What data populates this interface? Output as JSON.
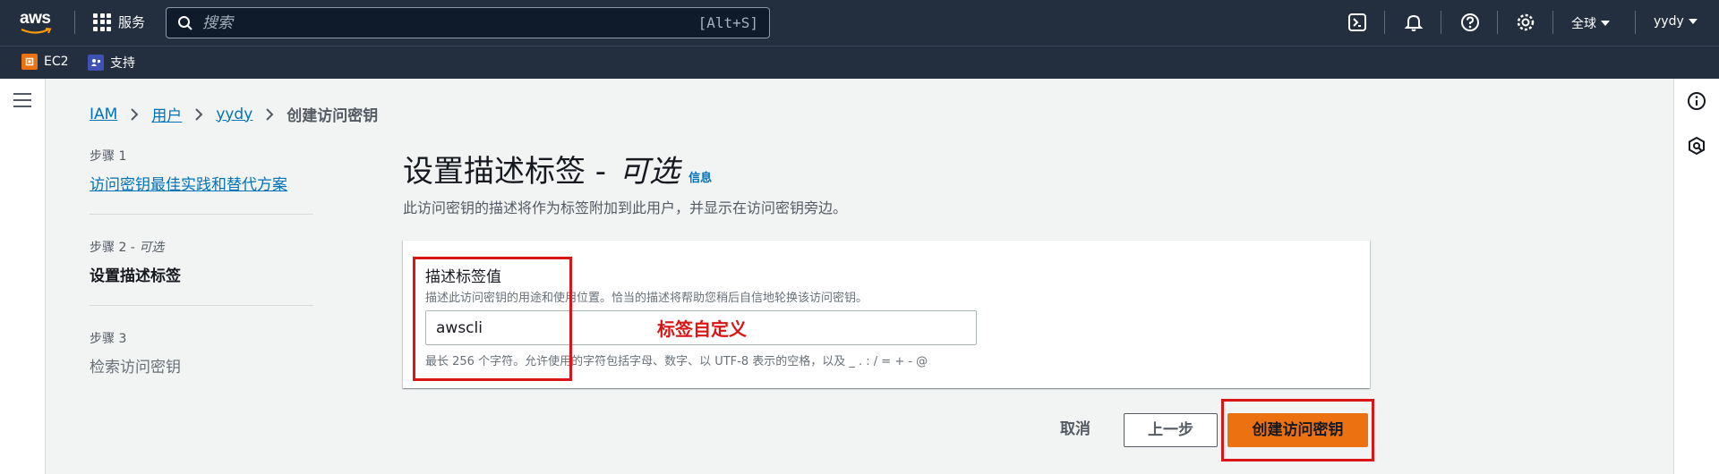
{
  "nav": {
    "logo_text": "aws",
    "services_label": "服务",
    "search_placeholder": "搜索",
    "search_shortcut": "[Alt+S]",
    "region_label": "全球",
    "user_label": "yydy"
  },
  "favorites": [
    {
      "label": "EC2",
      "color": "#ec7211"
    },
    {
      "label": "支持",
      "color": "#3f51b5"
    }
  ],
  "breadcrumb": {
    "items": [
      "IAM",
      "用户",
      "yydy"
    ],
    "current": "创建访问密钥"
  },
  "steps": [
    {
      "num": "步骤 1",
      "title": "访问密钥最佳实践和替代方案"
    },
    {
      "num": "步骤 2",
      "opt": "可选",
      "title": "设置描述标签"
    },
    {
      "num": "步骤 3",
      "title": "检索访问密钥"
    }
  ],
  "main": {
    "title": "设置描述标签 -",
    "title_opt": "可选",
    "info_link": "信息",
    "description": "此访问密钥的描述将作为标签附加到此用户，并显示在访问密钥旁边。"
  },
  "field": {
    "label": "描述标签值",
    "description": "描述此访问密钥的用途和使用位置。恰当的描述将帮助您稍后自信地轮换该访问密钥。",
    "value": "awscli",
    "hint": "最长 256 个字符。允许使用的字符包括字母、数字、以 UTF-8 表示的空格，以及 _ . : / = + - @"
  },
  "annotation": {
    "text": "标签自定义",
    "color": "#d91515"
  },
  "buttons": {
    "cancel": "取消",
    "previous": "上一步",
    "create": "创建访问密钥"
  },
  "colors": {
    "nav_bg": "#232f3e",
    "primary": "#ec7211",
    "link": "#0073bb"
  }
}
